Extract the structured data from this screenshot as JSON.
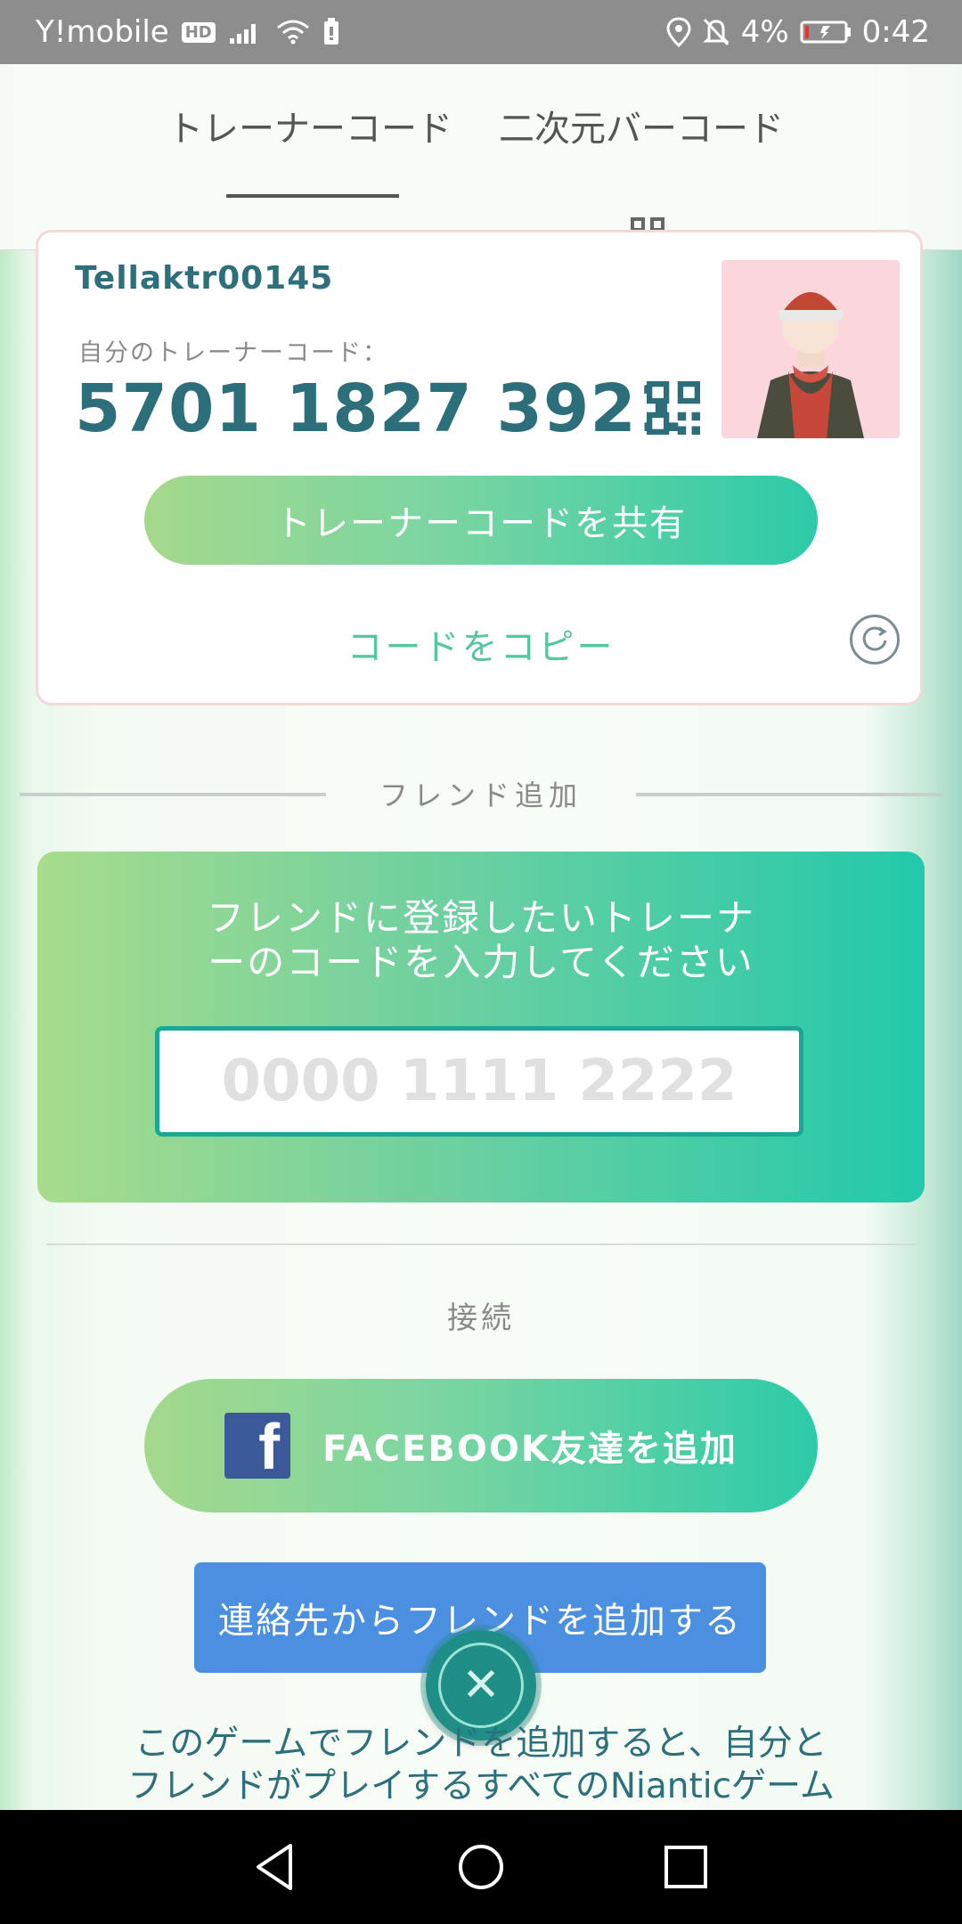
{
  "status_bar": {
    "carrier": "Y!mobile",
    "hd_badge": "HD",
    "battery_percent": "4%",
    "time": "0:42"
  },
  "tabs": [
    {
      "label": "トレーナーコード",
      "selected": true
    },
    {
      "label": "二次元バーコード",
      "selected": false
    }
  ],
  "trainer_card": {
    "username": "Tellaktr00145",
    "code_label": "自分のトレーナーコード：",
    "code": "5701 1827 3921",
    "share_button": "トレーナーコードを共有",
    "copy_button": "コードをコピー"
  },
  "add_friend": {
    "section_title": "フレンド追加",
    "prompt_line1": "フレンドに登録したいトレーナ",
    "prompt_line2": "ーのコードを入力してください",
    "input_placeholder": "0000 1111 2222",
    "input_value": ""
  },
  "connect": {
    "section_title": "接続",
    "facebook_button": "FACEBOOK友達を追加",
    "contacts_button": "連絡先からフレンドを追加する"
  },
  "info_text_line1": "このゲームでフレンドを追加すると、自分と",
  "info_text_line2": "フレンドがプレイするすべてのNianticゲーム",
  "colors": {
    "accent_teal": "#2c6f7b",
    "green_gradient_start": "#a5d98c",
    "green_gradient_end": "#2ccba8",
    "facebook_blue": "#3b5998",
    "contacts_blue": "#4b8fe0"
  },
  "icons": [
    "qr-code-icon",
    "refresh-icon",
    "facebook-icon",
    "close-icon",
    "nav-back-icon",
    "nav-home-icon",
    "nav-recents-icon"
  ]
}
